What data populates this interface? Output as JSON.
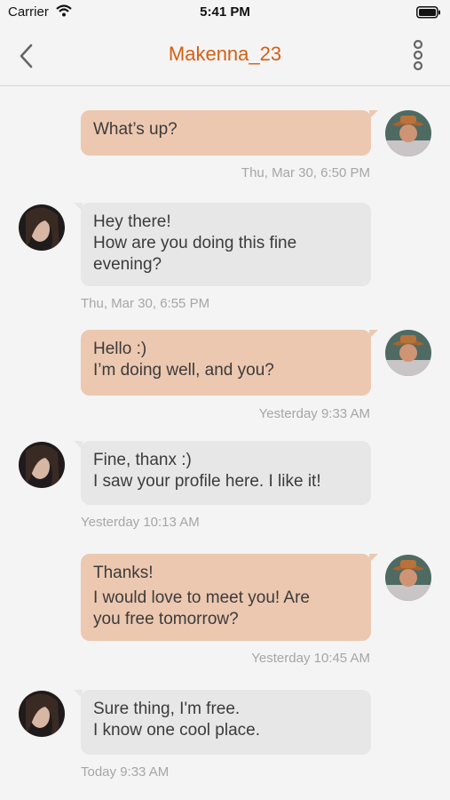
{
  "status": {
    "carrier": "Carrier",
    "time": "5:41 PM"
  },
  "header": {
    "title": "Makenna_23"
  },
  "colors": {
    "accent": "#d55f12",
    "outgoing_bubble": "#ecc8b0",
    "incoming_bubble": "#e7e7e7"
  },
  "icons": {
    "back": "chevron-left-icon",
    "more": "vertical-dots-icon"
  },
  "messages": [
    {
      "from": "me",
      "lines": [
        "What’s up?"
      ],
      "time": "Thu, Mar 30, 6:50 PM"
    },
    {
      "from": "them",
      "lines": [
        "Hey there!",
        "How are you doing this fine",
        "evening?"
      ],
      "time": "Thu, Mar 30, 6:55 PM"
    },
    {
      "from": "me",
      "lines": [
        "Hello :)",
        "I’m doing well, and you?"
      ],
      "time": "Yesterday 9:33 AM"
    },
    {
      "from": "them",
      "lines": [
        "Fine, thanx :)",
        "I saw your profile here. I like it!"
      ],
      "time": "Yesterday 10:13 AM"
    },
    {
      "from": "me",
      "lines": [
        "Thanks!",
        "I would love to meet you! Are",
        "you free tomorrow?"
      ],
      "time": "Yesterday 10:45 AM"
    },
    {
      "from": "them",
      "lines": [
        "Sure thing, I'm free.",
        "I know one cool place."
      ],
      "time": "Today 9:33 AM"
    }
  ]
}
